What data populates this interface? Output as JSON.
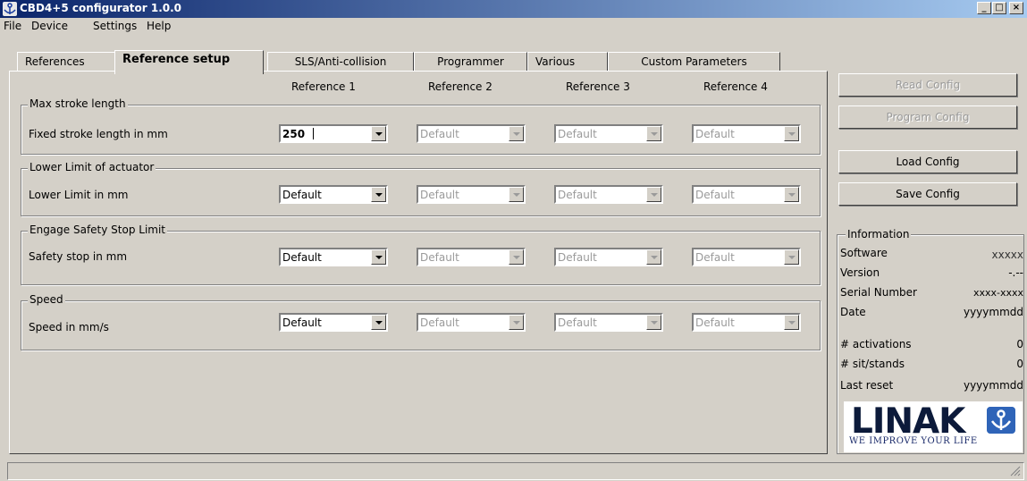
{
  "window": {
    "title": "CBD4+5 configurator 1.0.0",
    "minimize": "_",
    "maximize": "□",
    "close": "×"
  },
  "menu": [
    "File",
    "Device",
    "Settings",
    "Help"
  ],
  "tabs": [
    "References",
    "Reference setup",
    "SLS/Anti-collision",
    "Programmer",
    "Various",
    "Custom Parameters"
  ],
  "active_tab": "Reference setup",
  "columns": [
    "Reference 1",
    "Reference 2",
    "Reference 3",
    "Reference 4"
  ],
  "groups": [
    {
      "title": "Max stroke length",
      "label": "Fixed stroke length in mm",
      "values": [
        "250",
        "Default",
        "Default",
        "Default"
      ]
    },
    {
      "title": "Lower Limit of actuator",
      "label": "Lower Limit in mm",
      "values": [
        "Default",
        "Default",
        "Default",
        "Default"
      ]
    },
    {
      "title": "Engage Safety Stop Limit",
      "label": "Safety stop in mm",
      "values": [
        "Default",
        "Default",
        "Default",
        "Default"
      ]
    },
    {
      "title": "Speed",
      "label": "Speed in mm/s",
      "values": [
        "Default",
        "Default",
        "Default",
        "Default"
      ]
    }
  ],
  "buttons": {
    "read_config": "Read Config",
    "program_config": "Program Config",
    "load_config": "Load Config",
    "save_config": "Save Config"
  },
  "information": {
    "title": "Information",
    "rows": [
      {
        "label": "Software",
        "value": "xxxxx"
      },
      {
        "label": "Version",
        "value": "-.--"
      },
      {
        "label": "Serial Number",
        "value": "xxxx-xxxx"
      },
      {
        "label": "Date",
        "value": "yyyymmdd"
      },
      {
        "label": "# activations",
        "value": "0"
      },
      {
        "label": "# sit/stands",
        "value": "0"
      },
      {
        "label": "Last reset",
        "value": "yyyymmdd"
      }
    ]
  },
  "logo": {
    "text": "LINAK",
    "tagline": "WE IMPROVE YOUR LIFE"
  },
  "colors": {
    "title_start": "#0a246a",
    "title_end": "#a6caf0",
    "face": "#d4d0c8",
    "logo_blue": "#2f64b8"
  }
}
